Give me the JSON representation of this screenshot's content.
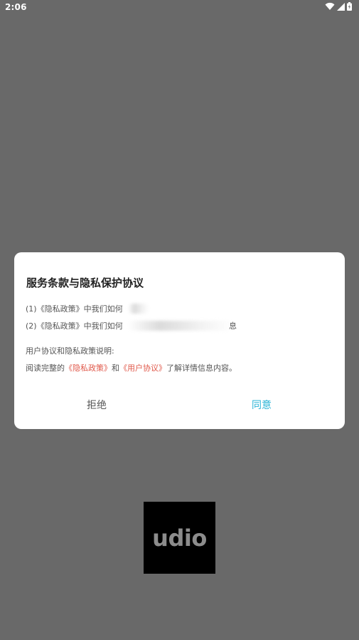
{
  "status_bar": {
    "time": "2:06",
    "icons": [
      "wifi-icon",
      "cellular-signal-icon",
      "battery-icon"
    ]
  },
  "dialog": {
    "title": "服务条款与隐私保护协议",
    "lines": [
      {
        "text": "(1)《隐私政策》中我们如何"
      },
      {
        "text": "(2)《隐私政策》中我们如何",
        "tail": "息"
      }
    ],
    "note_title": "用户协议和隐私政策说明:",
    "note": {
      "prefix": "阅读完整的",
      "privacy_link": "《隐私政策》",
      "and": "和",
      "user_link": "《用户协议》",
      "suffix": "了解详情信息内容。"
    },
    "reject_label": "拒绝",
    "agree_label": "同意"
  },
  "logo": {
    "text": "udio"
  },
  "colors": {
    "overlay": "#696969",
    "link": "#e0584a",
    "agree": "#2bb4d6"
  }
}
